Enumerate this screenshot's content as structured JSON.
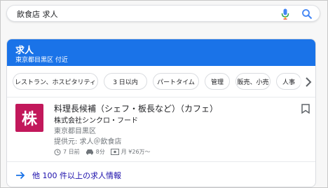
{
  "search": {
    "query": "飲食店 求人"
  },
  "card": {
    "title": "求人",
    "subtitle": "東京都目黒区 付近",
    "chips": [
      "レストラン、ホスピタリティ",
      "3 日以内",
      "パートタイム",
      "管理",
      "販売、小売",
      "人事"
    ],
    "job": {
      "logo_char": "株",
      "title": "料理長候補（シェフ・板長など）（カフェ）",
      "company": "株式会社シンクロ・フード",
      "location": "東京都目黒区",
      "via": "提供元: 求人＠飲食店",
      "posted": "7 日前",
      "commute": "8分",
      "salary": "月 ¥26万〜"
    },
    "more_link": "他 100 件以上の求人情報"
  },
  "colors": {
    "header": "#1a73e8",
    "logo": "#c2185b",
    "link": "#1a0dab"
  }
}
